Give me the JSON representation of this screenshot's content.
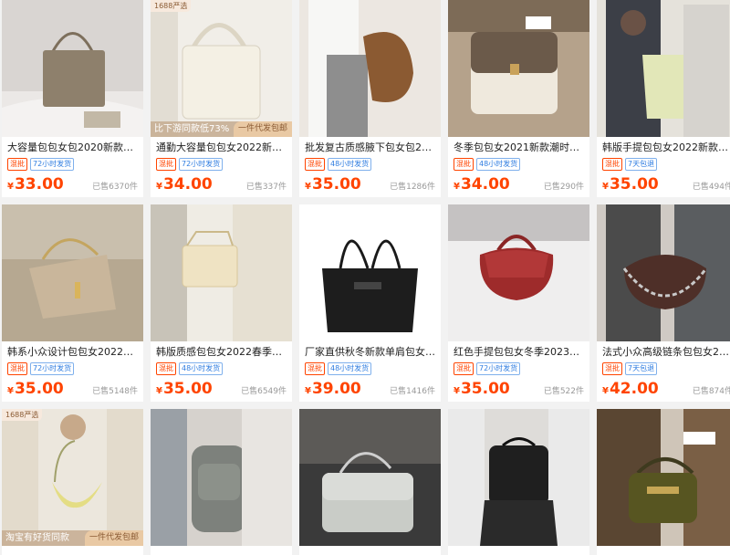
{
  "currency_symbol": "¥",
  "colors": {
    "price": "#ff4400",
    "badge_blue": "#2f7de1",
    "badge_red": "#ff4400"
  },
  "products": [
    {
      "title": "大容量包包女包2020新款潮网...",
      "badges": [
        "混批",
        "72小时发货"
      ],
      "price": "33.00",
      "sold": "已售6370件",
      "img": "beige-tote-bed"
    },
    {
      "title": "通勤大容量包包女2022新款大...",
      "badges": [
        "混批",
        "72小时发货"
      ],
      "price": "34.00",
      "sold": "已售337件",
      "img": "cream-shoulder-bag",
      "tag": "1688严选",
      "promo_left": "比下游同款低73%",
      "promo_right": "一件代发包邮"
    },
    {
      "title": "批发复古质感腋下包女包2023...",
      "badges": [
        "混批",
        "48小时发货"
      ],
      "price": "35.00",
      "sold": "已售1286件",
      "img": "brown-hobo-bag"
    },
    {
      "title": "冬季包包女2021新款潮时尚撞...",
      "badges": [
        "混批",
        "48小时发货"
      ],
      "price": "34.00",
      "sold": "已售290件",
      "img": "twotone-flap-bag"
    },
    {
      "title": "韩版手提包包女2022新款时尚...",
      "badges": [
        "混批",
        "7天包退"
      ],
      "price": "35.00",
      "sold": "已售494件",
      "img": "green-bucket-bag"
    },
    {
      "title": "韩系小众设计包包女2022新款...",
      "badges": [
        "混批",
        "72小时发货"
      ],
      "price": "35.00",
      "sold": "已售5148件",
      "img": "taupe-shoulder-bag"
    },
    {
      "title": "韩版质感包包女2022春季新款...",
      "badges": [
        "混批",
        "48小时发货"
      ],
      "price": "35.00",
      "sold": "已售6549件",
      "img": "quilted-cream-bag"
    },
    {
      "title": "厂家直供秋冬新款单肩包女欧美...",
      "badges": [
        "混批",
        "48小时发货"
      ],
      "price": "39.00",
      "sold": "已售1416件",
      "img": "black-tote-bag"
    },
    {
      "title": "红色手提包包女冬季2023新款...",
      "badges": [
        "混批",
        "72小时发货"
      ],
      "price": "35.00",
      "sold": "已售522件",
      "img": "red-saddle-bag"
    },
    {
      "title": "法式小众高级链条包包女2023...",
      "badges": [
        "混批",
        "7天包退"
      ],
      "price": "42.00",
      "sold": "已售874件",
      "img": "brown-chain-bag"
    },
    {
      "img": "yellow-moon-bag",
      "tag": "1688严选",
      "promo_left": "淘宝有好货同款",
      "promo_right": "一件代发包邮"
    },
    {
      "img": "grey-backpack"
    },
    {
      "img": "silver-messenger-bag"
    },
    {
      "img": "black-mini-backpack"
    },
    {
      "img": "olive-buckle-bag"
    }
  ]
}
